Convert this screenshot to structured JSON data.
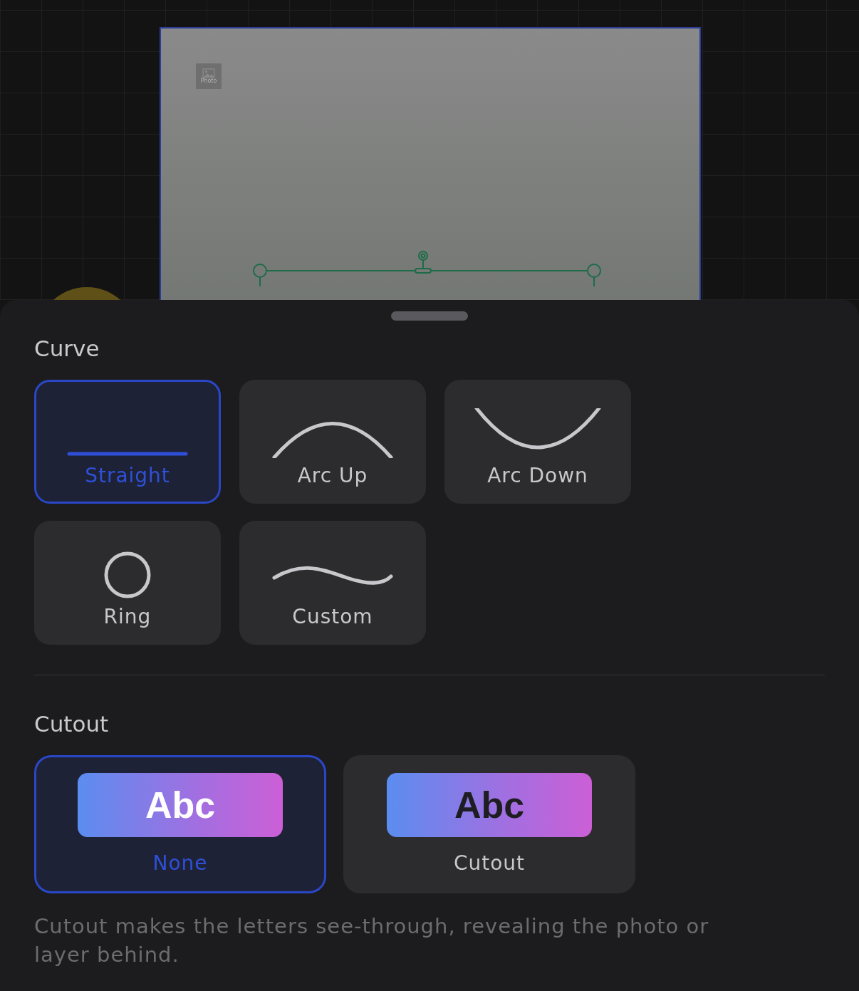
{
  "canvas": {
    "photo_label": "Photo"
  },
  "curve": {
    "title": "Curve",
    "options": [
      {
        "label": "Straight",
        "kind": "straight",
        "selected": true
      },
      {
        "label": "Arc Up",
        "kind": "arc-up",
        "selected": false
      },
      {
        "label": "Arc Down",
        "kind": "arc-down",
        "selected": false
      },
      {
        "label": "Ring",
        "kind": "ring",
        "selected": false
      },
      {
        "label": "Custom",
        "kind": "custom",
        "selected": false
      }
    ]
  },
  "cutout": {
    "title": "Cutout",
    "options": [
      {
        "label": "None",
        "preview": "Abc",
        "kind": "none",
        "selected": true
      },
      {
        "label": "Cutout",
        "preview": "Abc",
        "kind": "cutout",
        "selected": false
      }
    ]
  },
  "description": "Cutout makes the letters see-through, revealing the photo or layer behind."
}
